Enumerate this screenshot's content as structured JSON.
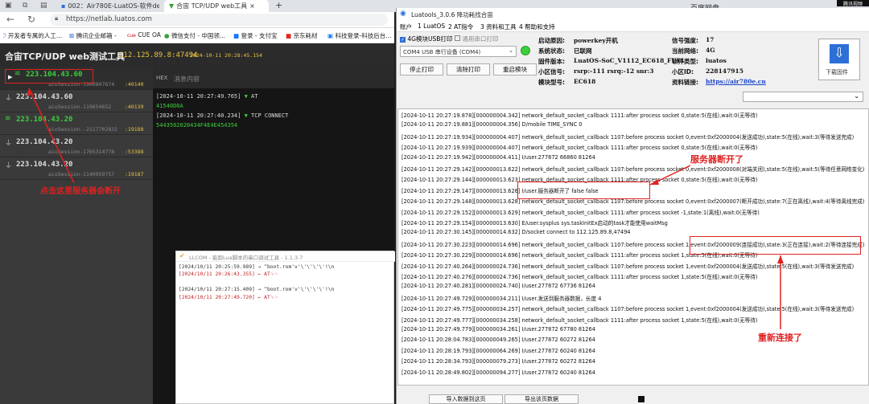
{
  "browser": {
    "tabs": [
      "002：Air780E-LuatOS-软件demo",
      "合宙 TCP/UDP web工具"
    ],
    "url": "https://netlab.luatos.com",
    "favorites": [
      "开发者专属的人工...",
      "腾讯企业邮箱 -",
      "CUE OA",
      "微信支付 - 中国领...",
      "登录 - 支付宝",
      "京东耗材",
      "科技登录-科技后台..."
    ],
    "right_tab": "百度网盘",
    "corner": "腾讯视频"
  },
  "webtool": {
    "title": "合宙TCP/UDP web测试工具",
    "address": "112.125.89.8:47494",
    "time": "2024-10-11 20:28:45.154",
    "hex": "HEX",
    "msg_tab": "消息内容",
    "connections": [
      {
        "ip": "223.104.43.60",
        "session": "aioSession-1900807674",
        "port": ":40140",
        "active": true
      },
      {
        "ip": "223.104.43.60",
        "session": "aioSession-119654652",
        "port": ":40139",
        "active": false
      },
      {
        "ip": "223.104.43.20",
        "session": "aioSession--2117702832",
        "port": ":19188",
        "active": true
      },
      {
        "ip": "223.104.43.20",
        "session": "aioSession-1765314778",
        "port": ":53388",
        "active": false
      },
      {
        "ip": "223.104.43.20",
        "session": "aioSession-1140959757",
        "port": ":19187",
        "active": false
      }
    ],
    "messages": [
      {
        "time": "[2024-10-11 20:27:49.765]",
        "label": "AT",
        "data": "41540D0A"
      },
      {
        "time": "[2024-10-11 20:27:40.234]",
        "label": "TCP  CONNECT",
        "data": "5443502020434F4E4E454354"
      }
    ]
  },
  "llcom": {
    "title": "LLCOM - 能跑Lua脚本的串口调试工具 - 1.1.3.7",
    "lines": [
      "[2024/10/11 20:25:59.989]  →  ^boot.rom'v'\\'\\'\\'\\'!\\n",
      "[2024/10/11 20:26:43.355]  ←  AT␍␊",
      "[2024/10/11 20:27:15.409]  →  ^boot.rom'v'\\'\\'\\'\\'!\\n",
      "[2024/10/11 20:27:49.720]  ←  AT␍␊"
    ]
  },
  "luatools": {
    "title": "Luatools_3.0.6 降功耗找合宙",
    "menu": [
      "账户",
      "1 LuatOS",
      "2 AT指令",
      "3 资料和工具",
      "4 帮助和支持"
    ],
    "checkbox1": "4G模块USB打印",
    "checkbox2": "通用串口打印",
    "port": "COM4 USB 串行设备 (COM4)",
    "buttons": [
      "停止打印",
      "清除打印",
      "重启模块"
    ],
    "download": "下载固件",
    "info": [
      [
        "启动原因:",
        "powerkey开机"
      ],
      [
        "系统状态:",
        "已联网"
      ],
      [
        "固件版本:",
        "LuatOS-SoC_V1112_EC618_FULL"
      ],
      [
        "小区信号:",
        "rsrp:-111 rsrq:-12 snr:3"
      ],
      [
        "模块型号:",
        "EC618"
      ]
    ],
    "info2": [
      [
        "信号强度:",
        "17"
      ],
      [
        "当前网络:",
        "4G"
      ],
      [
        "软件类型:",
        "luatos"
      ],
      [
        "小区ID:",
        "228147915"
      ],
      [
        "资料链接:",
        "https://air780e.cn"
      ]
    ],
    "bottom": [
      "导入数据到这页",
      "导出该页数据"
    ],
    "logs": [
      "[2024-10-11 20:27:19.878][000000004.342] network_default_socket_callback 1111:after process socket 0,state:5(在线),wait:0(无等待)",
      "[2024-10-11 20:27:19.881][000000004.356] D/mobile TIME_SYNC 0",
      "[2024-10-11 20:27:19.934][000000004.407] network_default_socket_callback 1107:before process socket 0,event:0xf2000004(发送成功),state:5(在线),wait:3(等待发送完成)",
      "[2024-10-11 20:27:19.939][000000004.407] network_default_socket_callback 1111:after process socket 0,state:5(在线),wait:0(无等待)",
      "[2024-10-11 20:27:19.942][000000004.411] I/user.277872  66860   81264",
      "[2024-10-11 20:27:29.142][000000013.622] network_default_socket_callback 1107:before process socket 0,event:0xf2000008(对端关闭),state:5(在线),wait:5(等待任意网络变化)",
      "[2024-10-11 20:27:29.144][000000013.623] network_default_socket_callback 1111:after process socket 0,state:5(在线),wait:0(无等待)",
      "[2024-10-11 20:27:29.147][000000013.626] I/user.服务器断开了      false    false",
      "[2024-10-11 20:27:29.148][000000013.628] network_default_socket_callback 1107:before process socket 0,event:0xf2000007(断开成功),state:7(正在离线),wait:4(等待离线完成)",
      "[2024-10-11 20:27:29.152][000000013.629] network_default_socket_callback 1111:after process socket -1,state:1(离线),wait:0(无等待)",
      "[2024-10-11 20:27:29.154][000000013.630] E/user.sysplus sys.taskInitEx启动的task才能使用waitMsg",
      "[2024-10-11 20:27:30.145][000000014.632] D/socket connect to 112.125.89.8,47494",
      "[2024-10-11 20:27:30.223][000000014.696] network_default_socket_callback 1107:before process socket 1,event:0xf2000009(连接成功),state:3(正在连接),wait:2(等待连接完成)",
      "[2024-10-11 20:27:30.229][000000014.696] network_default_socket_callback 1111:after process socket 1,state:5(在线),wait:0(无等待)",
      "[2024-10-11 20:27:40.264][000000024.736] network_default_socket_callback 1107:before process socket 1,event:0xf2000004(发送成功),state:5(在线),wait:3(等待发送完成)",
      "[2024-10-11 20:27:40.276][000000024.736] network_default_socket_callback 1111:after process socket 1,state:5(在线),wait:0(无等待)",
      "[2024-10-11 20:27:40.281][000000024.740] I/user.277872  67736   81264",
      "[2024-10-11 20:27:49.729][000000034.211] I/user.发送到服务器数据，长度    4",
      "[2024-10-11 20:27:49.775][000000034.257] network_default_socket_callback 1107:before process socket 1,event:0xf2000004(发送成功),state:5(在线),wait:3(等待发送完成)",
      "[2024-10-11 20:27:49.777][000000034.258] network_default_socket_callback 1111:after process socket 1,state:5(在线),wait:0(无等待)",
      "[2024-10-11 20:27:49.779][000000034.261] I/user.277872  67780   81264",
      "[2024-10-11 20:28:04.783][000000049.265] I/user.277872  60272   81264",
      "[2024-10-11 20:28:19.793][000000064.269] I/user.277872  60240   81264",
      "[2024-10-11 20:28:34.793][000000079.273] I/user.277872  60272   81264",
      "[2024-10-11 20:28:49.802][000000094.277] I/user.277872  60240   81264"
    ]
  },
  "annotations": {
    "click": "点击这里服务器会断开",
    "disconnected": "服务器断开了",
    "reconnected": "重新连接了"
  },
  "colors": {
    "accent_red": "#e02020",
    "green": "#3ccf3c",
    "port_yellow": "#e8c040"
  }
}
